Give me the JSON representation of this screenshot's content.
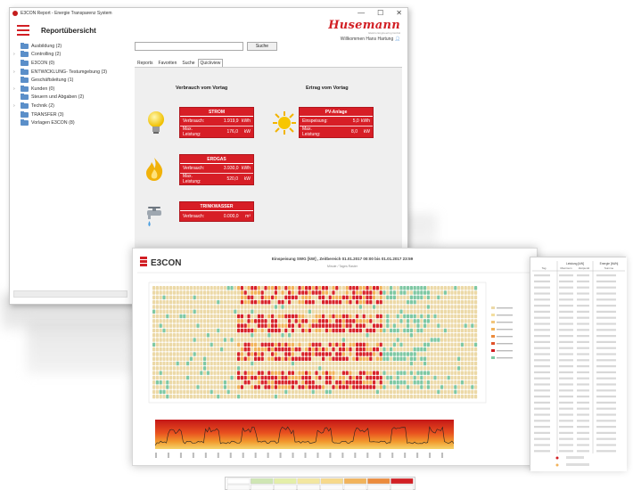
{
  "window": {
    "title": "E3CON Report - Energie Transparenz System",
    "controls": [
      "—",
      "☐",
      "✕"
    ]
  },
  "header": {
    "title": "Reportübersicht",
    "brand": "Husemann",
    "brand_sub": "Elektro Engineering GmbH",
    "welcome": "Willkommen Hans Hartung",
    "user_icon": "person-icon",
    "menu_icon": "hamburger-menu-icon"
  },
  "sidebar": {
    "items": [
      {
        "label": "Ausbildung (2)",
        "expandable": false
      },
      {
        "label": "Controlling (2)",
        "expandable": true
      },
      {
        "label": "E3CON (0)",
        "expandable": false
      },
      {
        "label": "ENTWICKLUNG- Testumgebung (3)",
        "expandable": true
      },
      {
        "label": "Geschäftsleitung (1)",
        "expandable": false
      },
      {
        "label": "Kunden (0)",
        "expandable": true
      },
      {
        "label": "Steuern und Abgaben (2)",
        "expandable": false
      },
      {
        "label": "Technik (2)",
        "expandable": true
      },
      {
        "label": "TRANSFER (3)",
        "expandable": false
      },
      {
        "label": "Vorlagen E3CON (8)",
        "expandable": false
      }
    ]
  },
  "search": {
    "placeholder": "",
    "button_label": "Suche"
  },
  "tabs": [
    "Reports",
    "Favoriten",
    "Suche",
    "Quickview"
  ],
  "active_tab": "Quickview",
  "quickview": {
    "left_title": "Verbrauch vom Vortag",
    "right_title": "Ertrag vom Vortag",
    "cards": {
      "strom": {
        "title": "STROM",
        "icon": "lightbulb-icon",
        "rows": [
          {
            "label": "Verbrauch:",
            "value": "1.919,9",
            "unit": "kWh"
          },
          {
            "label": "Max. Leistung:",
            "value": "176,0",
            "unit": "kW"
          }
        ]
      },
      "erdgas": {
        "title": "ERDGAS",
        "icon": "flame-icon",
        "rows": [
          {
            "label": "Verbrauch:",
            "value": "3.930,0",
            "unit": "kWh"
          },
          {
            "label": "Max. Leistung:",
            "value": "520,0",
            "unit": "kW"
          }
        ]
      },
      "trinkwasser": {
        "title": "TRINKWASSER",
        "icon": "water-tap-icon",
        "rows": [
          {
            "label": "Verbrauch:",
            "value": "0.000,0",
            "unit": "m³"
          }
        ]
      },
      "pv": {
        "title": "PV-Anlage",
        "icon": "sun-icon",
        "rows": [
          {
            "label": "Einspeisung:",
            "value": "5,0",
            "unit": "kWh"
          },
          {
            "label": "Max. Leistung:",
            "value": "8,0",
            "unit": "kW"
          }
        ]
      }
    }
  },
  "report": {
    "logo": "E3CON",
    "title": "Einspeisung SWG [kW] , Zeitbereich 01.01.2017 00:00 bis 01.01.2017 23:59",
    "subtitle": "Minute / Tages Raster",
    "colors": {
      "low": "#ecd9a7",
      "mid": "#f2b35a",
      "high": "#d8232a",
      "dot": "#7fc8a3"
    }
  },
  "report_table": {
    "header1": "Leistung [kW]",
    "header2": "Energie [kWh]",
    "cols": [
      "Tag",
      "Maximum",
      "Zeitpunkt",
      "Summe"
    ]
  }
}
